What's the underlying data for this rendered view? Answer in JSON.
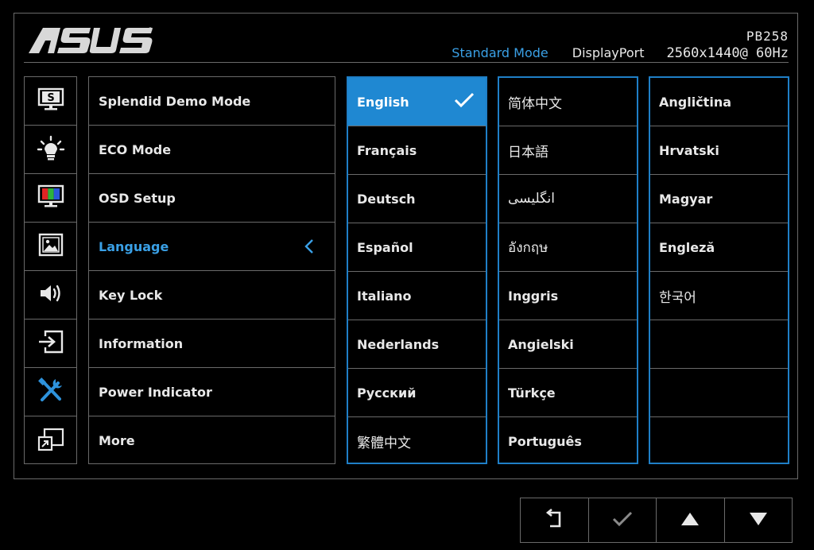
{
  "header": {
    "brand": "ASUS",
    "model": "PB258",
    "mode": "Standard Mode",
    "input": "DisplayPort",
    "resolution": "2560x1440@ 60Hz"
  },
  "colors": {
    "accent": "#3aa0e6",
    "selection": "#1f88d2",
    "border": "#6a6a6a",
    "column_border": "#1f7fc7"
  },
  "categories": [
    {
      "icon": "splendid-icon"
    },
    {
      "icon": "blue-light-icon"
    },
    {
      "icon": "color-icon"
    },
    {
      "icon": "image-icon"
    },
    {
      "icon": "sound-icon"
    },
    {
      "icon": "input-select-icon"
    },
    {
      "icon": "system-setup-icon",
      "active": true
    },
    {
      "icon": "pip-icon"
    }
  ],
  "menu": {
    "items": [
      {
        "label": "Splendid Demo Mode"
      },
      {
        "label": "ECO Mode"
      },
      {
        "label": "OSD Setup"
      },
      {
        "label": "Language",
        "active": true
      },
      {
        "label": "Key Lock"
      },
      {
        "label": "Information"
      },
      {
        "label": "Power Indicator"
      },
      {
        "label": "More"
      }
    ]
  },
  "languages": {
    "col1": [
      "English",
      "Français",
      "Deutsch",
      "Español",
      "Italiano",
      "Nederlands",
      "Русский",
      "繁體中文"
    ],
    "col2": [
      "简体中文",
      "日本語",
      "انگلیسی",
      "อังกฤษ",
      "Inggris",
      "Angielski",
      "Türkçe",
      "Português"
    ],
    "col3": [
      "Angličtina",
      "Hrvatski",
      "Magyar",
      "Engleză",
      "한국어",
      "",
      "",
      ""
    ],
    "selected": "English"
  },
  "nav_buttons": [
    {
      "icon": "return-icon"
    },
    {
      "icon": "check-icon"
    },
    {
      "icon": "up-arrow-icon"
    },
    {
      "icon": "down-arrow-icon"
    }
  ]
}
